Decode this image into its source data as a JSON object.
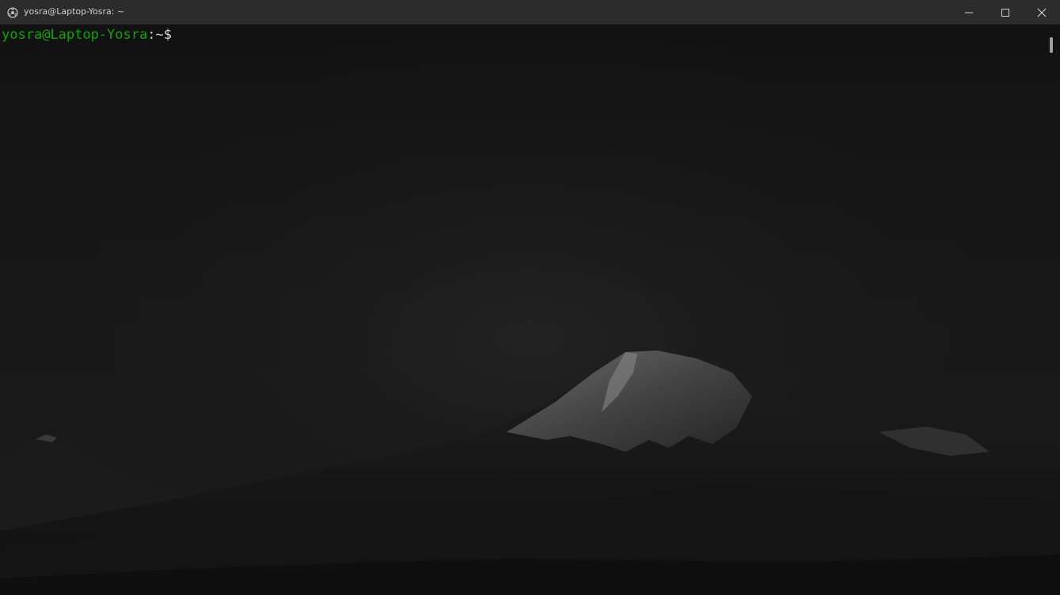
{
  "window": {
    "title": "yosra@Laptop-Yosra: ~",
    "app_icon": "linux-penguin-icon",
    "controls": {
      "minimize_icon": "minimize-icon",
      "maximize_icon": "maximize-icon",
      "close_icon": "close-icon"
    }
  },
  "terminal": {
    "prompt": {
      "user_host": "yosra@Laptop-Yosra",
      "separator": ":",
      "path": "~",
      "symbol": "$"
    },
    "background": "dark mountain landscape wallpaper",
    "colors": {
      "user_host": "#13a10e",
      "path": "#cfcfcf",
      "background": "#111111"
    }
  }
}
